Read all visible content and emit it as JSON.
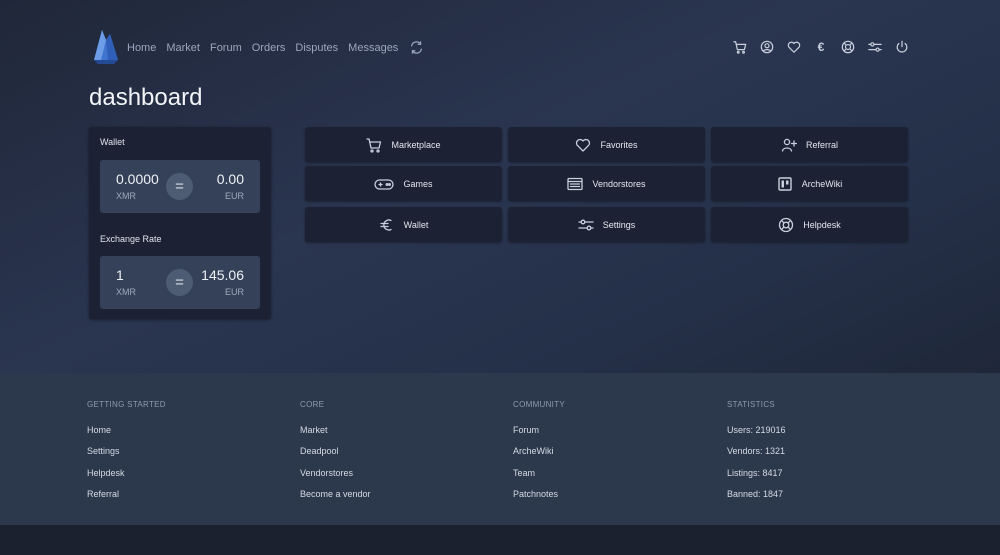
{
  "nav": {
    "links": [
      "Home",
      "Market",
      "Forum",
      "Orders",
      "Disputes",
      "Messages"
    ],
    "icons": [
      "cart-icon",
      "user-icon",
      "heart-icon",
      "euro-icon",
      "lifebuoy-icon",
      "sliders-icon",
      "power-icon"
    ],
    "euro_symbol": "€"
  },
  "page": {
    "title": "dashboard"
  },
  "wallet_card": {
    "wallet_label": "Wallet",
    "wallet": {
      "left_value": "0.0000",
      "left_unit": "XMR",
      "right_value": "0.00",
      "right_unit": "EUR",
      "equals": "="
    },
    "rate_label": "Exchange Rate",
    "rate": {
      "left_value": "1",
      "left_unit": "XMR",
      "right_value": "145.06",
      "right_unit": "EUR",
      "equals": "="
    }
  },
  "quick_links": [
    {
      "label": "Marketplace",
      "icon": "cart-icon"
    },
    {
      "label": "Favorites",
      "icon": "heart-icon"
    },
    {
      "label": "Referral",
      "icon": "add-user-icon"
    },
    {
      "label": "Games",
      "icon": "gamepad-icon"
    },
    {
      "label": "Vendorstores",
      "icon": "store-list-icon"
    },
    {
      "label": "ArcheWiki",
      "icon": "wiki-icon"
    },
    {
      "label": "Wallet",
      "icon": "euro-icon"
    },
    {
      "label": "Settings",
      "icon": "sliders-icon"
    },
    {
      "label": "Helpdesk",
      "icon": "lifebuoy-icon"
    }
  ],
  "footer": {
    "getting_started": {
      "heading": "GETTING STARTED",
      "items": [
        "Home",
        "Settings",
        "Helpdesk",
        "Referral"
      ]
    },
    "core": {
      "heading": "CORE",
      "items": [
        "Market",
        "Deadpool",
        "Vendorstores",
        "Become a vendor"
      ]
    },
    "community": {
      "heading": "COMMUNITY",
      "items": [
        "Forum",
        "ArcheWiki",
        "Team",
        "Patchnotes"
      ]
    },
    "statistics": {
      "heading": "STATISTICS",
      "items": [
        "Users: 219016",
        "Vendors: 1321",
        "Listings: 8417",
        "Banned: 1847"
      ]
    }
  },
  "colors": {
    "accent_logo": "#4a7fd8",
    "card_bg": "#1c2233",
    "value_box_bg": "#344158",
    "footer_bg": "#2c394d"
  }
}
